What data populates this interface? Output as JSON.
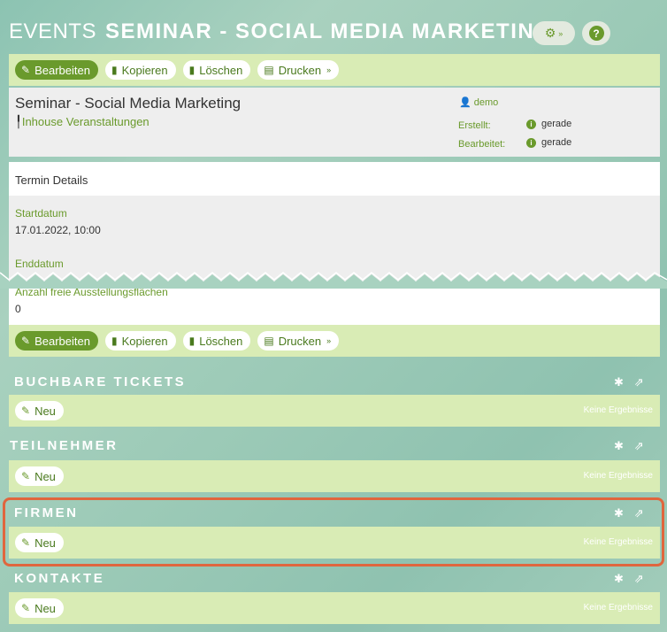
{
  "header": {
    "module": "EVENTS",
    "record": "SEMINAR - SOCIAL MEDIA MARKETING",
    "settings_icon": "gear-icon",
    "help_icon": "question-icon"
  },
  "toolbar": {
    "edit": "Bearbeiten",
    "copy": "Kopieren",
    "delete": "Löschen",
    "print": "Drucken"
  },
  "detail": {
    "title": "Seminar - Social Media Marketing",
    "category": "Inhouse Veranstaltungen",
    "user": "demo",
    "created_label": "Erstellt:",
    "created_value": "gerade",
    "edited_label": "Bearbeitet:",
    "edited_value": "gerade"
  },
  "termin": {
    "heading": "Termin Details",
    "start_label": "Startdatum",
    "start_value": "17.01.2022, 10:00",
    "end_label": "Enddatum",
    "free_label": "Anzahl freie Ausstellungsflächen",
    "free_value": "0"
  },
  "sections": [
    {
      "title": "BUCHBARE TICKETS",
      "new_label": "Neu",
      "empty": "Keine Ergebnisse"
    },
    {
      "title": "TEILNEHMER",
      "new_label": "Neu",
      "empty": "Keine Ergebnisse"
    },
    {
      "title": "FIRMEN",
      "new_label": "Neu",
      "empty": "Keine Ergebnisse"
    },
    {
      "title": "KONTAKTE",
      "new_label": "Neu",
      "empty": "Keine Ergebnisse"
    }
  ],
  "colors": {
    "accent": "#6a9a2c",
    "bar": "#d9ecb5",
    "highlight": "#e0663e"
  }
}
